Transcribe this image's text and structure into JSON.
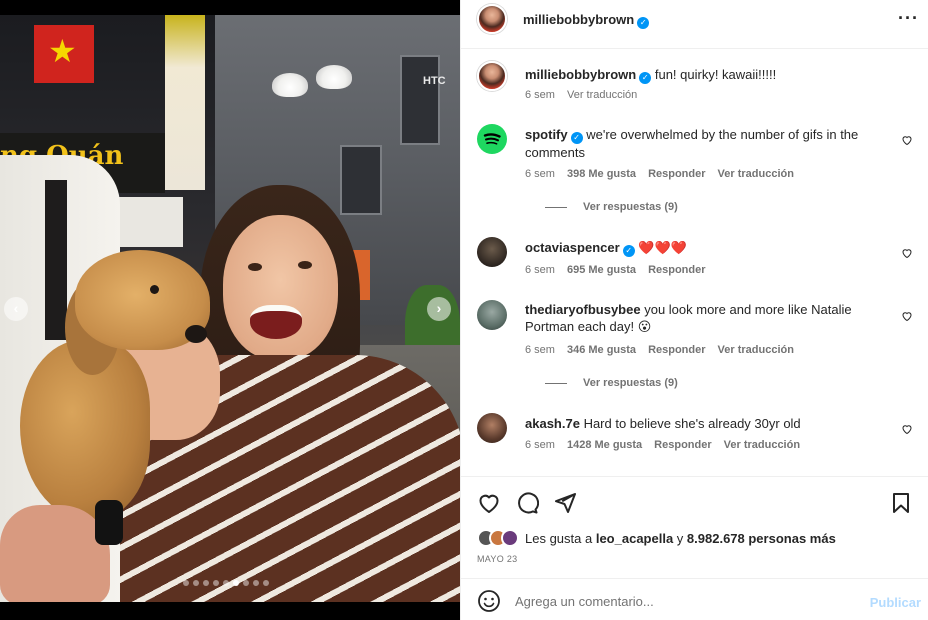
{
  "post": {
    "username": "milliebobbybrown",
    "more_label": "···",
    "carousel": {
      "slides": 9,
      "active_index": 5
    }
  },
  "caption": {
    "username": "milliebobbybrown",
    "text": "fun! quirky! kawaii!!!!!",
    "time": "6 sem",
    "translate": "Ver traducción"
  },
  "photo_signs": {
    "shop": "ng Quán",
    "street": "HTC"
  },
  "comments": [
    {
      "username": "spotify",
      "verified": true,
      "text": "we're overwhelmed by the number of gifs in the comments",
      "time": "6 sem",
      "likes": "398 Me gusta",
      "reply": "Responder",
      "translate": "Ver traducción",
      "replies": "Ver respuestas (9)"
    },
    {
      "username": "octaviaspencer",
      "verified": true,
      "text": "❤️❤️❤️",
      "time": "6 sem",
      "likes": "695 Me gusta",
      "reply": "Responder"
    },
    {
      "username": "thediaryofbusybee",
      "verified": false,
      "text": "you look more and more like Natalie Portman each day! 😮",
      "time": "6 sem",
      "likes": "346 Me gusta",
      "reply": "Responder",
      "translate": "Ver traducción",
      "replies": "Ver respuestas (9)"
    },
    {
      "username": "akash.7e",
      "verified": false,
      "text": "Hard to believe she's already 30yr old",
      "time": "6 sem",
      "likes": "1428 Me gusta",
      "reply": "Responder",
      "translate": "Ver traducción"
    }
  ],
  "likes_line": {
    "prefix": "Les gusta a",
    "user": "leo_acapella",
    "joiner": "y",
    "others": "8.982.678 personas más"
  },
  "date": "MAYO 23",
  "add_comment": {
    "placeholder": "Agrega un comentario...",
    "publish": "Publicar"
  },
  "colors": {
    "verified": "#0095f6",
    "spotify": "#1ed760",
    "publish_disabled": "#b3dbff"
  }
}
